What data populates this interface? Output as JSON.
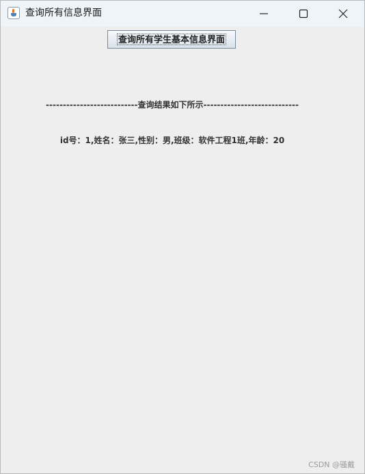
{
  "window": {
    "title": "查询所有信息界面",
    "app_icon": "java-coffee-cup-icon",
    "controls": {
      "minimize_icon": "minimize-icon",
      "maximize_icon": "maximize-icon",
      "close_icon": "close-icon"
    }
  },
  "main": {
    "query_button_label": "查询所有学生基本信息界面",
    "result_header": "---------------------------查询结果如下所示----------------------------",
    "results": [
      "id号：1,姓名：张三,性别：男,班级：软件工程1班,年龄：20"
    ]
  },
  "watermark": "CSDN @骚戴",
  "colors": {
    "titlebar_bg": "#eff4f9",
    "window_bg": "#eeeeee",
    "text": "#333333"
  }
}
